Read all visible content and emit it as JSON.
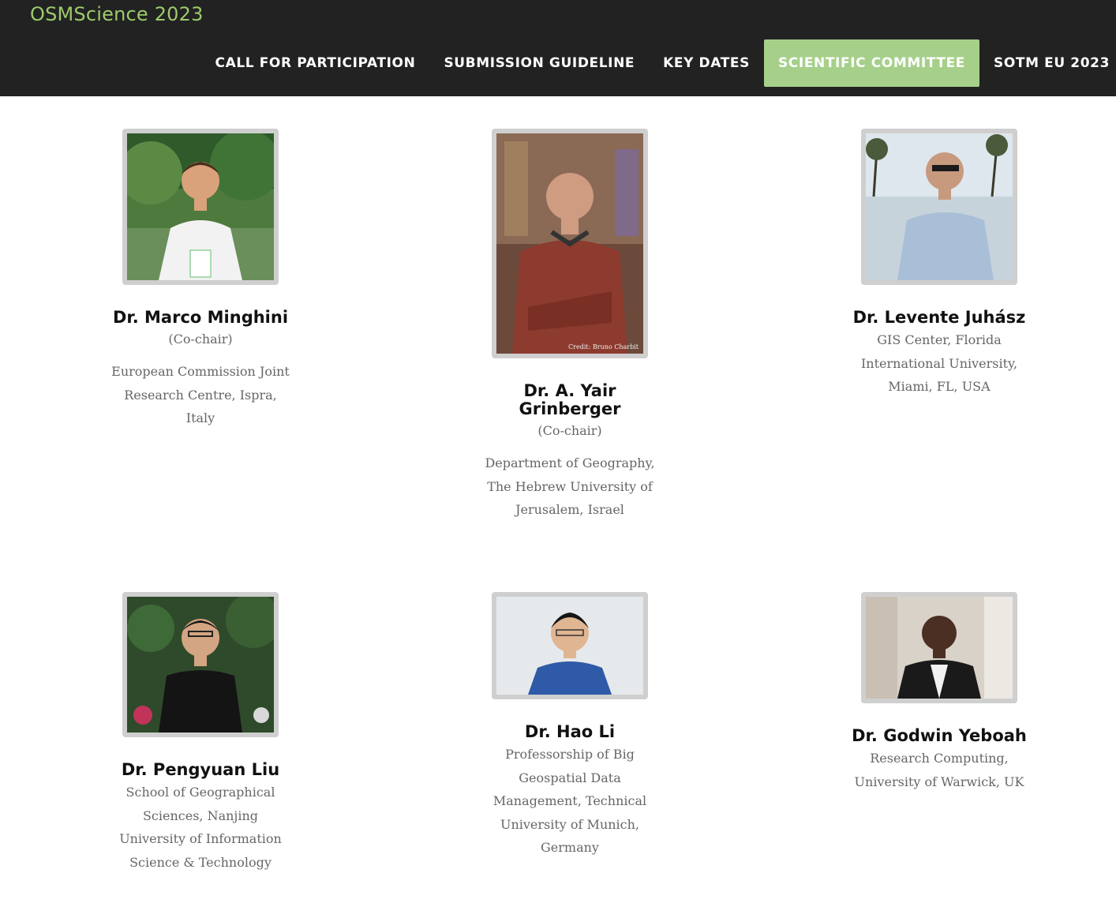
{
  "site": {
    "title": "OSMScience 2023"
  },
  "nav": {
    "items": [
      {
        "label": "CALL FOR PARTICIPATION"
      },
      {
        "label": "SUBMISSION GUIDELINE"
      },
      {
        "label": "KEY DATES"
      },
      {
        "label": "SCIENTIFIC COMMITTEE"
      },
      {
        "label": "SOTM EU 2023"
      }
    ],
    "active_index": 3
  },
  "colors": {
    "header_bg": "#222222",
    "accent": "#9ccb6b",
    "active_tab": "#a6d08a"
  },
  "committee": [
    {
      "name": "Dr. Marco Minghini",
      "role": "(Co-chair)",
      "affiliation": "European Commission Joint Research Centre, Ispra, Italy"
    },
    {
      "name": "Dr. A. Yair Grinberger",
      "role": "(Co-chair)",
      "affiliation": "Department of Geography, The Hebrew University of Jerusalem, Israel",
      "photo_credit": "Credit: Bruno Charbit"
    },
    {
      "name": "Dr. Levente Juhász",
      "role": "",
      "affiliation": "GIS Center, Florida International University, Miami, FL, USA"
    },
    {
      "name": "Dr. Pengyuan Liu",
      "role": "",
      "affiliation": "School of Geographical Sciences, Nanjing University of Information Science & Technology"
    },
    {
      "name": "Dr. Hao Li",
      "role": "",
      "affiliation": "Professorship of Big Geospatial Data Management, Technical University of Munich, Germany"
    },
    {
      "name": "Dr. Godwin Yeboah",
      "role": "",
      "affiliation": "Research Computing, University of Warwick, UK"
    }
  ]
}
